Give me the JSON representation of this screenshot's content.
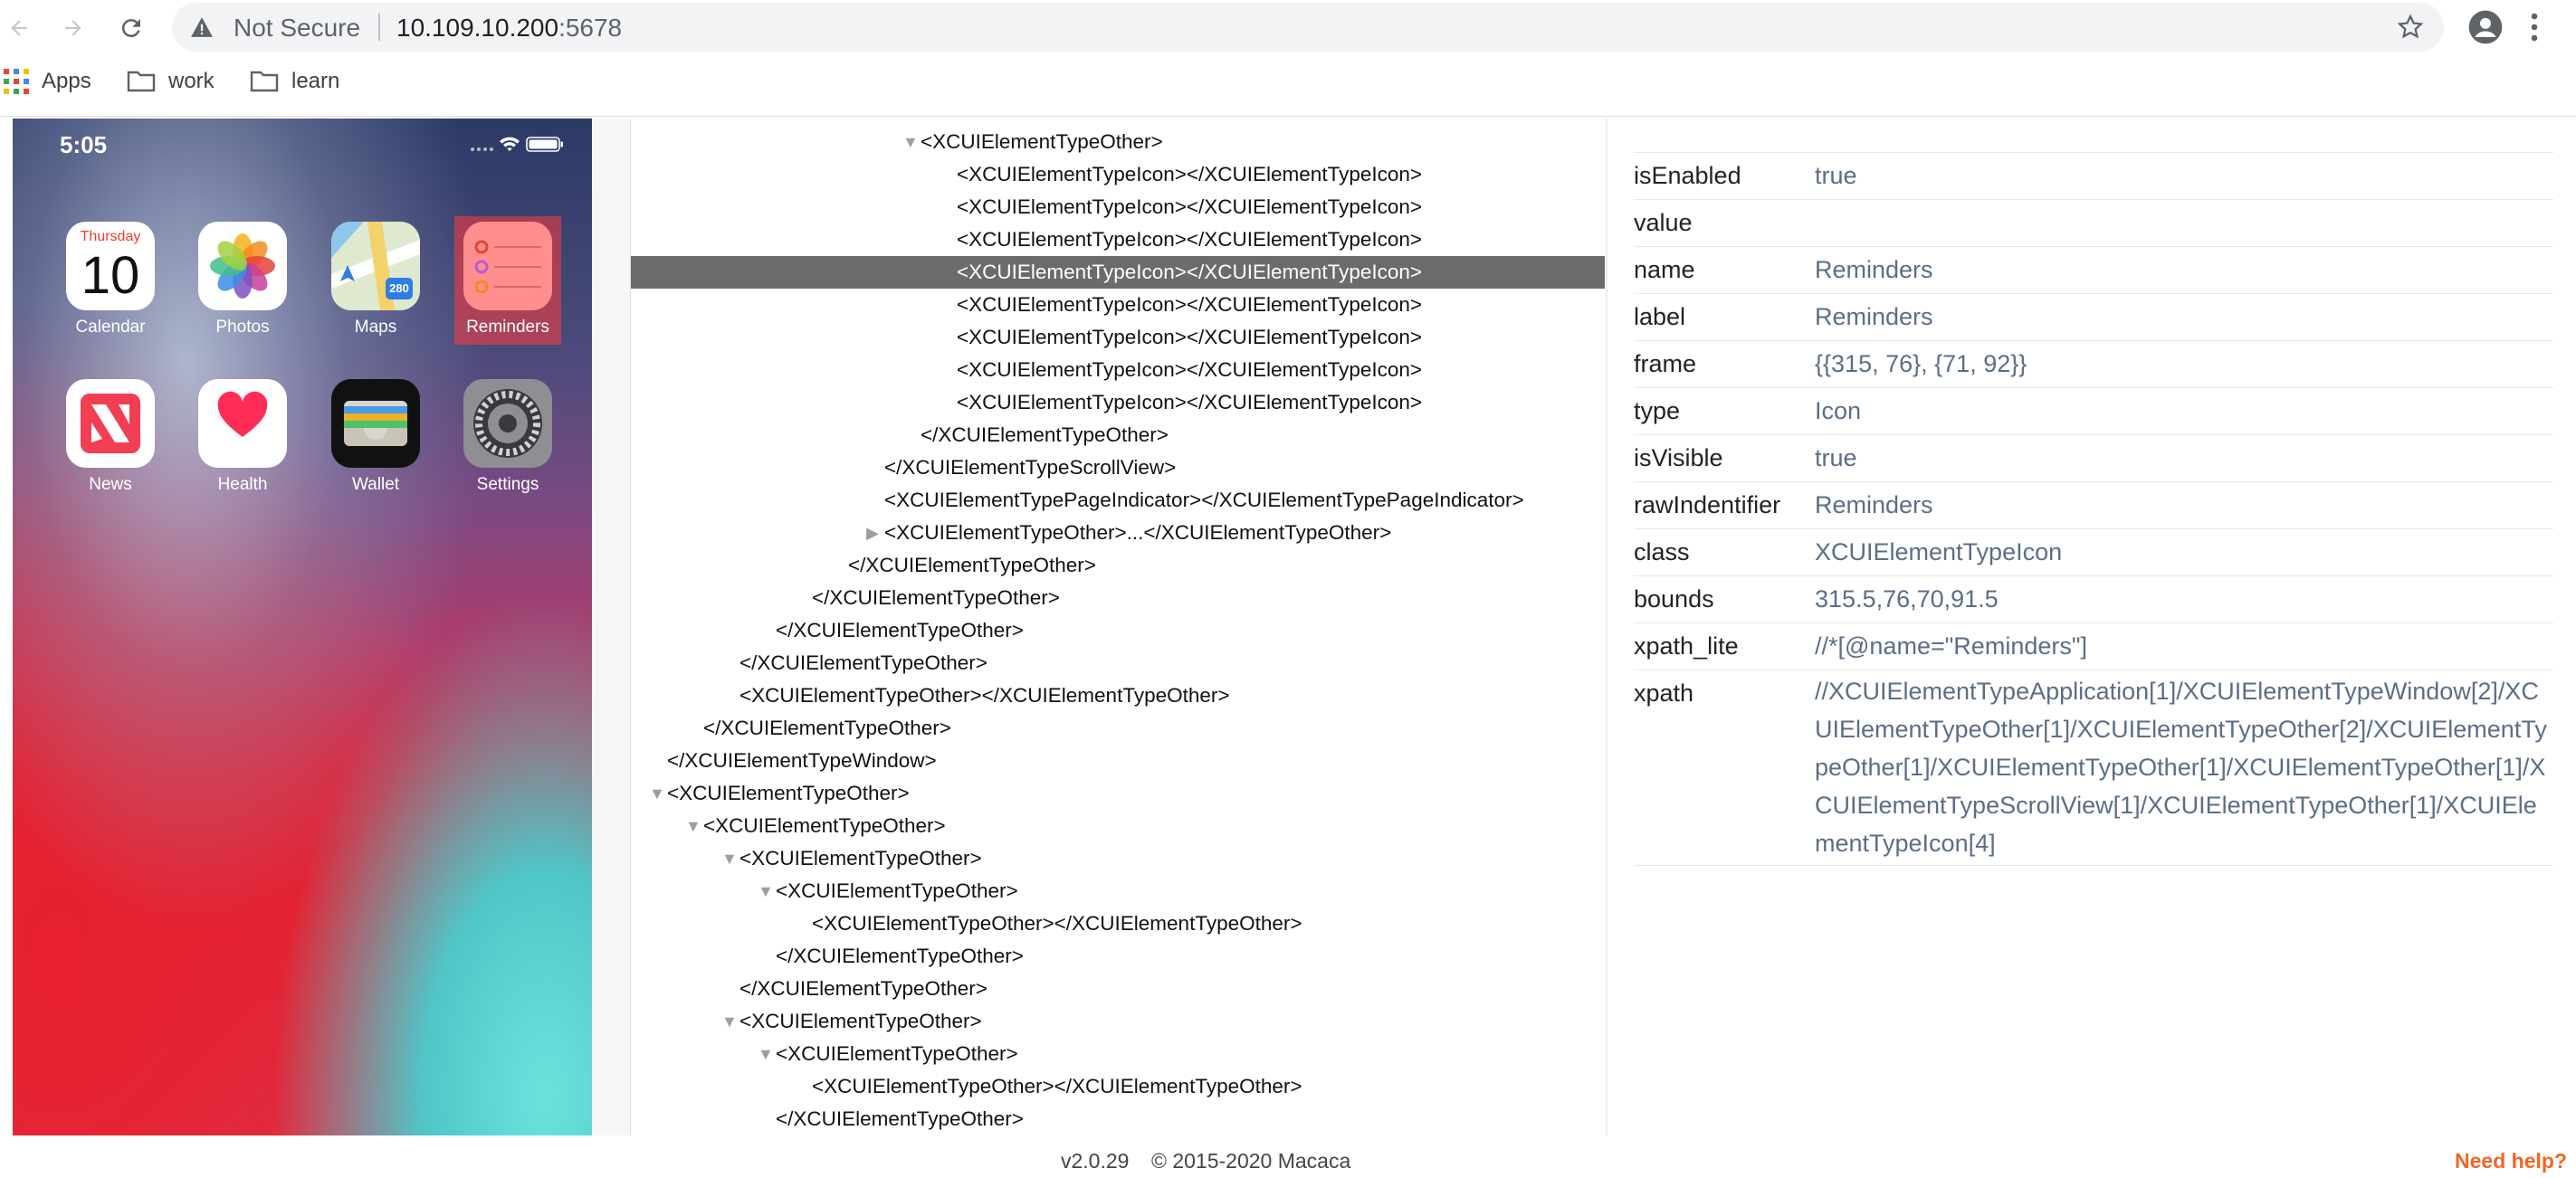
{
  "browser": {
    "security_text": "Not Secure",
    "url_host": "10.109.10.200",
    "url_port": ":5678",
    "bookmarks": [
      {
        "label": "Apps"
      },
      {
        "label": "work"
      },
      {
        "label": "learn"
      }
    ]
  },
  "phone": {
    "time": "5:05",
    "calendar_day_name": "Thursday",
    "calendar_day_number": "10",
    "apps": [
      {
        "label": "Calendar",
        "icon": "calendar-icon"
      },
      {
        "label": "Photos",
        "icon": "photos-icon"
      },
      {
        "label": "Maps",
        "icon": "maps-icon"
      },
      {
        "label": "Reminders",
        "icon": "reminders-icon"
      },
      {
        "label": "News",
        "icon": "news-icon"
      },
      {
        "label": "Health",
        "icon": "health-icon"
      },
      {
        "label": "Wallet",
        "icon": "wallet-icon"
      },
      {
        "label": "Settings",
        "icon": "settings-icon"
      }
    ],
    "maps_badge": "280"
  },
  "tree": {
    "rows": [
      {
        "depth": 8,
        "toggle": "open",
        "text": "<XCUIElementTypeOther>"
      },
      {
        "depth": 9,
        "toggle": "none",
        "text": "<XCUIElementTypeIcon></XCUIElementTypeIcon>"
      },
      {
        "depth": 9,
        "toggle": "none",
        "text": "<XCUIElementTypeIcon></XCUIElementTypeIcon>"
      },
      {
        "depth": 9,
        "toggle": "none",
        "text": "<XCUIElementTypeIcon></XCUIElementTypeIcon>"
      },
      {
        "depth": 9,
        "toggle": "none",
        "text": "<XCUIElementTypeIcon></XCUIElementTypeIcon>",
        "selected": true
      },
      {
        "depth": 9,
        "toggle": "none",
        "text": "<XCUIElementTypeIcon></XCUIElementTypeIcon>"
      },
      {
        "depth": 9,
        "toggle": "none",
        "text": "<XCUIElementTypeIcon></XCUIElementTypeIcon>"
      },
      {
        "depth": 9,
        "toggle": "none",
        "text": "<XCUIElementTypeIcon></XCUIElementTypeIcon>"
      },
      {
        "depth": 9,
        "toggle": "none",
        "text": "<XCUIElementTypeIcon></XCUIElementTypeIcon>"
      },
      {
        "depth": 8,
        "toggle": "none",
        "text": "</XCUIElementTypeOther>"
      },
      {
        "depth": 7,
        "toggle": "none",
        "text": "</XCUIElementTypeScrollView>"
      },
      {
        "depth": 7,
        "toggle": "none",
        "text": "<XCUIElementTypePageIndicator></XCUIElementTypePageIndicator>"
      },
      {
        "depth": 7,
        "toggle": "closed",
        "text": "<XCUIElementTypeOther>...</XCUIElementTypeOther>"
      },
      {
        "depth": 6,
        "toggle": "none",
        "text": "</XCUIElementTypeOther>"
      },
      {
        "depth": 5,
        "toggle": "none",
        "text": "</XCUIElementTypeOther>"
      },
      {
        "depth": 4,
        "toggle": "none",
        "text": "</XCUIElementTypeOther>"
      },
      {
        "depth": 3,
        "toggle": "none",
        "text": "</XCUIElementTypeOther>"
      },
      {
        "depth": 3,
        "toggle": "none",
        "text": "<XCUIElementTypeOther></XCUIElementTypeOther>"
      },
      {
        "depth": 2,
        "toggle": "none",
        "text": "</XCUIElementTypeOther>"
      },
      {
        "depth": 1,
        "toggle": "none",
        "text": "</XCUIElementTypeWindow>"
      },
      {
        "depth": 1,
        "toggle": "open",
        "text": "<XCUIElementTypeOther>"
      },
      {
        "depth": 2,
        "toggle": "open",
        "text": "<XCUIElementTypeOther>"
      },
      {
        "depth": 3,
        "toggle": "open",
        "text": "<XCUIElementTypeOther>"
      },
      {
        "depth": 4,
        "toggle": "open",
        "text": "<XCUIElementTypeOther>"
      },
      {
        "depth": 5,
        "toggle": "none",
        "text": "<XCUIElementTypeOther></XCUIElementTypeOther>"
      },
      {
        "depth": 4,
        "toggle": "none",
        "text": "</XCUIElementTypeOther>"
      },
      {
        "depth": 3,
        "toggle": "none",
        "text": "</XCUIElementTypeOther>"
      },
      {
        "depth": 3,
        "toggle": "open",
        "text": "<XCUIElementTypeOther>"
      },
      {
        "depth": 4,
        "toggle": "open",
        "text": "<XCUIElementTypeOther>"
      },
      {
        "depth": 5,
        "toggle": "none",
        "text": "<XCUIElementTypeOther></XCUIElementTypeOther>"
      },
      {
        "depth": 4,
        "toggle": "none",
        "text": "</XCUIElementTypeOther>"
      }
    ]
  },
  "attributes": [
    {
      "key": "isEnabled",
      "value": "true"
    },
    {
      "key": "value",
      "value": ""
    },
    {
      "key": "name",
      "value": "Reminders"
    },
    {
      "key": "label",
      "value": "Reminders"
    },
    {
      "key": "frame",
      "value": "{{315, 76}, {71, 92}}"
    },
    {
      "key": "type",
      "value": "Icon"
    },
    {
      "key": "isVisible",
      "value": "true"
    },
    {
      "key": "rawIndentifier",
      "value": "Reminders"
    },
    {
      "key": "class",
      "value": "XCUIElementTypeIcon"
    },
    {
      "key": "bounds",
      "value": "315.5,76,70,91.5"
    },
    {
      "key": "xpath_lite",
      "value": "//*[@name=\"Reminders\"]"
    },
    {
      "key": "xpath",
      "value": "//XCUIElementTypeApplication[1]/XCUIElementTypeWindow[2]/XCUIElementTypeOther[1]/XCUIElementTypeOther[2]/XCUIElementTypeOther[1]/XCUIElementTypeOther[1]/XCUIElementTypeOther[1]/XCUIElementTypeScrollView[1]/XCUIElementTypeOther[1]/XCUIElementTypeIcon[4]"
    }
  ],
  "footer": {
    "version": "v2.0.29",
    "copyright": "© 2015-2020 Macaca",
    "help": "Need help?"
  },
  "colors": {
    "selected_row": "#6b6b6b",
    "attr_value": "#5b6e86",
    "help_link": "#f26522"
  }
}
